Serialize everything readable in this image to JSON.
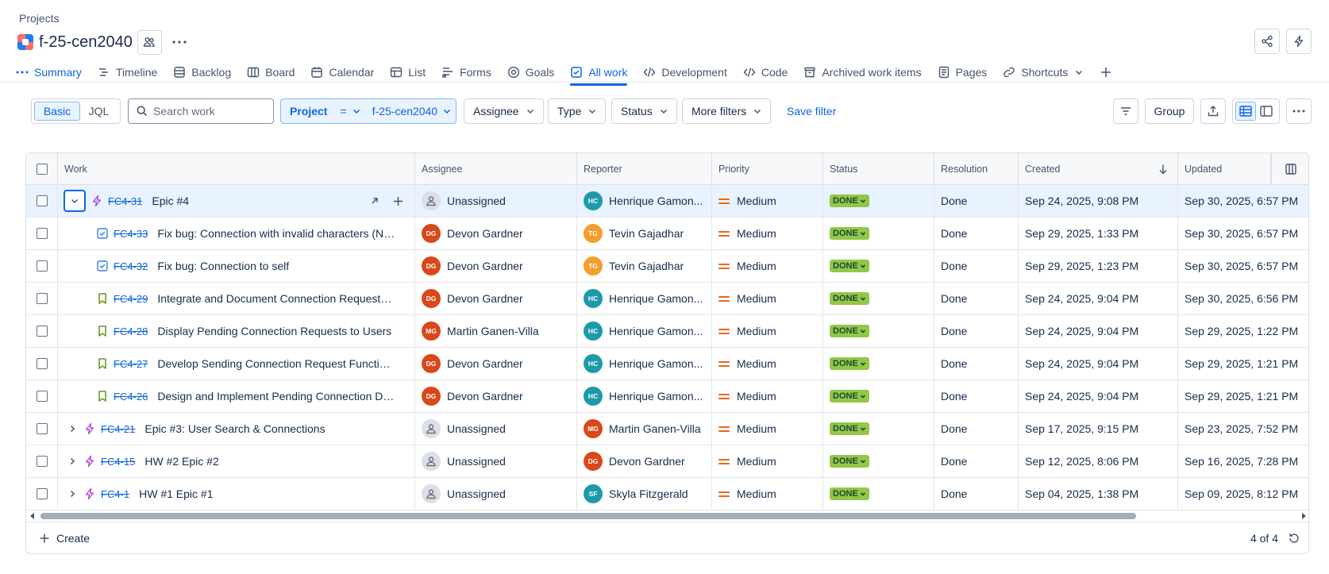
{
  "breadcrumb": "Projects",
  "project": {
    "title": "f-25-cen2040"
  },
  "tabs": [
    {
      "label": "Summary",
      "icon": "dots-icon",
      "active": false
    },
    {
      "label": "Timeline",
      "icon": "timeline-icon"
    },
    {
      "label": "Backlog",
      "icon": "backlog-icon"
    },
    {
      "label": "Board",
      "icon": "board-icon"
    },
    {
      "label": "Calendar",
      "icon": "calendar-icon"
    },
    {
      "label": "List",
      "icon": "list-icon"
    },
    {
      "label": "Forms",
      "icon": "forms-icon"
    },
    {
      "label": "Goals",
      "icon": "goals-icon"
    },
    {
      "label": "All work",
      "icon": "all-work-icon",
      "active": true
    },
    {
      "label": "Development",
      "icon": "code-icon"
    },
    {
      "label": "Code",
      "icon": "code-icon"
    },
    {
      "label": "Archived work items",
      "icon": "archive-icon"
    },
    {
      "label": "Pages",
      "icon": "pages-icon"
    },
    {
      "label": "Shortcuts",
      "icon": "link-icon"
    }
  ],
  "filters": {
    "basic_label": "Basic",
    "jql_label": "JQL",
    "search_placeholder": "Search work",
    "project_label": "Project",
    "project_operator": "=",
    "project_value": "f-25-cen2040",
    "assignee_label": "Assignee",
    "type_label": "Type",
    "status_label": "Status",
    "more_filters_label": "More filters",
    "save_filter_label": "Save filter",
    "group_label": "Group"
  },
  "table": {
    "columns": {
      "work": "Work",
      "assignee": "Assignee",
      "reporter": "Reporter",
      "priority": "Priority",
      "status": "Status",
      "resolution": "Resolution",
      "created": "Created",
      "updated": "Updated"
    },
    "rows": [
      {
        "key": "FC4-31",
        "summary": "Epic #4",
        "type": "epic",
        "assignee": "Unassigned",
        "reporter": "Henrique Gamon...",
        "reporter_initials": "HC",
        "priority": "Medium",
        "status": "DONE",
        "resolution": "Done",
        "created": "Sep 24, 2025, 9:08 PM",
        "updated": "Sep 30, 2025, 6:57 PM"
      },
      {
        "key": "FC4-33",
        "summary": "Fix bug: Connection with invalid characters (Not ...",
        "type": "task",
        "assignee": "Devon Gardner",
        "assignee_initials": "DG",
        "reporter": "Tevin Gajadhar",
        "reporter_initials": "TG",
        "priority": "Medium",
        "status": "DONE",
        "resolution": "Done",
        "created": "Sep 29, 2025, 1:33 PM",
        "updated": "Sep 30, 2025, 6:57 PM"
      },
      {
        "key": "FC4-32",
        "summary": "Fix bug: Connection to self",
        "type": "task",
        "assignee": "Devon Gardner",
        "assignee_initials": "DG",
        "reporter": "Tevin Gajadhar",
        "reporter_initials": "TG",
        "priority": "Medium",
        "status": "DONE",
        "resolution": "Done",
        "created": "Sep 29, 2025, 1:23 PM",
        "updated": "Sep 30, 2025, 6:57 PM"
      },
      {
        "key": "FC4-29",
        "summary": "Integrate and Document Connection Requests F...",
        "type": "story",
        "assignee": "Devon Gardner",
        "assignee_initials": "DG",
        "reporter": "Henrique Gamon...",
        "reporter_initials": "HC",
        "priority": "Medium",
        "status": "DONE",
        "resolution": "Done",
        "created": "Sep 24, 2025, 9:04 PM",
        "updated": "Sep 30, 2025, 6:56 PM"
      },
      {
        "key": "FC4-28",
        "summary": "Display Pending Connection Requests to Users",
        "type": "story",
        "assignee": "Martin Ganen-Villa",
        "assignee_initials": "MG",
        "reporter": "Henrique Gamon...",
        "reporter_initials": "HC",
        "priority": "Medium",
        "status": "DONE",
        "resolution": "Done",
        "created": "Sep 24, 2025, 9:04 PM",
        "updated": "Sep 29, 2025, 1:22 PM"
      },
      {
        "key": "FC4-27",
        "summary": "Develop Sending Connection Request Functiona...",
        "type": "story",
        "assignee": "Devon Gardner",
        "assignee_initials": "DG",
        "reporter": "Henrique Gamon...",
        "reporter_initials": "HC",
        "priority": "Medium",
        "status": "DONE",
        "resolution": "Done",
        "created": "Sep 24, 2025, 9:04 PM",
        "updated": "Sep 29, 2025, 1:21 PM"
      },
      {
        "key": "FC4-26",
        "summary": "Design and Implement Pending Connection Dat...",
        "type": "story",
        "assignee": "Devon Gardner",
        "assignee_initials": "DG",
        "reporter": "Henrique Gamon...",
        "reporter_initials": "HC",
        "priority": "Medium",
        "status": "DONE",
        "resolution": "Done",
        "created": "Sep 24, 2025, 9:04 PM",
        "updated": "Sep 29, 2025, 1:21 PM"
      },
      {
        "key": "FC4-21",
        "summary": "Epic #3: User Search & Connections",
        "type": "epic",
        "assignee": "Unassigned",
        "reporter": "Martin Ganen-Villa",
        "reporter_initials": "MG",
        "priority": "Medium",
        "status": "DONE",
        "resolution": "Done",
        "created": "Sep 17, 2025, 9:15 PM",
        "updated": "Sep 23, 2025, 7:52 PM"
      },
      {
        "key": "FC4-15",
        "summary": "HW #2 Epic #2",
        "type": "epic",
        "assignee": "Unassigned",
        "reporter": "Devon Gardner",
        "reporter_initials": "DG",
        "priority": "Medium",
        "status": "DONE",
        "resolution": "Done",
        "created": "Sep 12, 2025, 8:06 PM",
        "updated": "Sep 16, 2025, 7:28 PM"
      },
      {
        "key": "FC4-1",
        "summary": "HW #1 Epic #1",
        "type": "epic",
        "assignee": "Unassigned",
        "reporter": "Skyla Fitzgerald",
        "reporter_initials": "SF",
        "priority": "Medium",
        "status": "DONE",
        "resolution": "Done",
        "created": "Sep 04, 2025, 1:38 PM",
        "updated": "Sep 09, 2025, 8:12 PM"
      }
    ]
  },
  "footer": {
    "create_label": "Create",
    "count": "4 of 4"
  },
  "colors": {
    "accent": "#0c66e4",
    "done_badge": "#94c748",
    "epic": "#ae4dd9",
    "story": "#6a9a23",
    "task": "#357de8",
    "priority_medium": "#e56910",
    "avatar_HC": "#1d9aaa",
    "avatar_TG": "#f59e2b",
    "avatar_DG": "#d9481a",
    "avatar_MG": "#d9481a",
    "avatar_SF": "#1d9aaa"
  }
}
